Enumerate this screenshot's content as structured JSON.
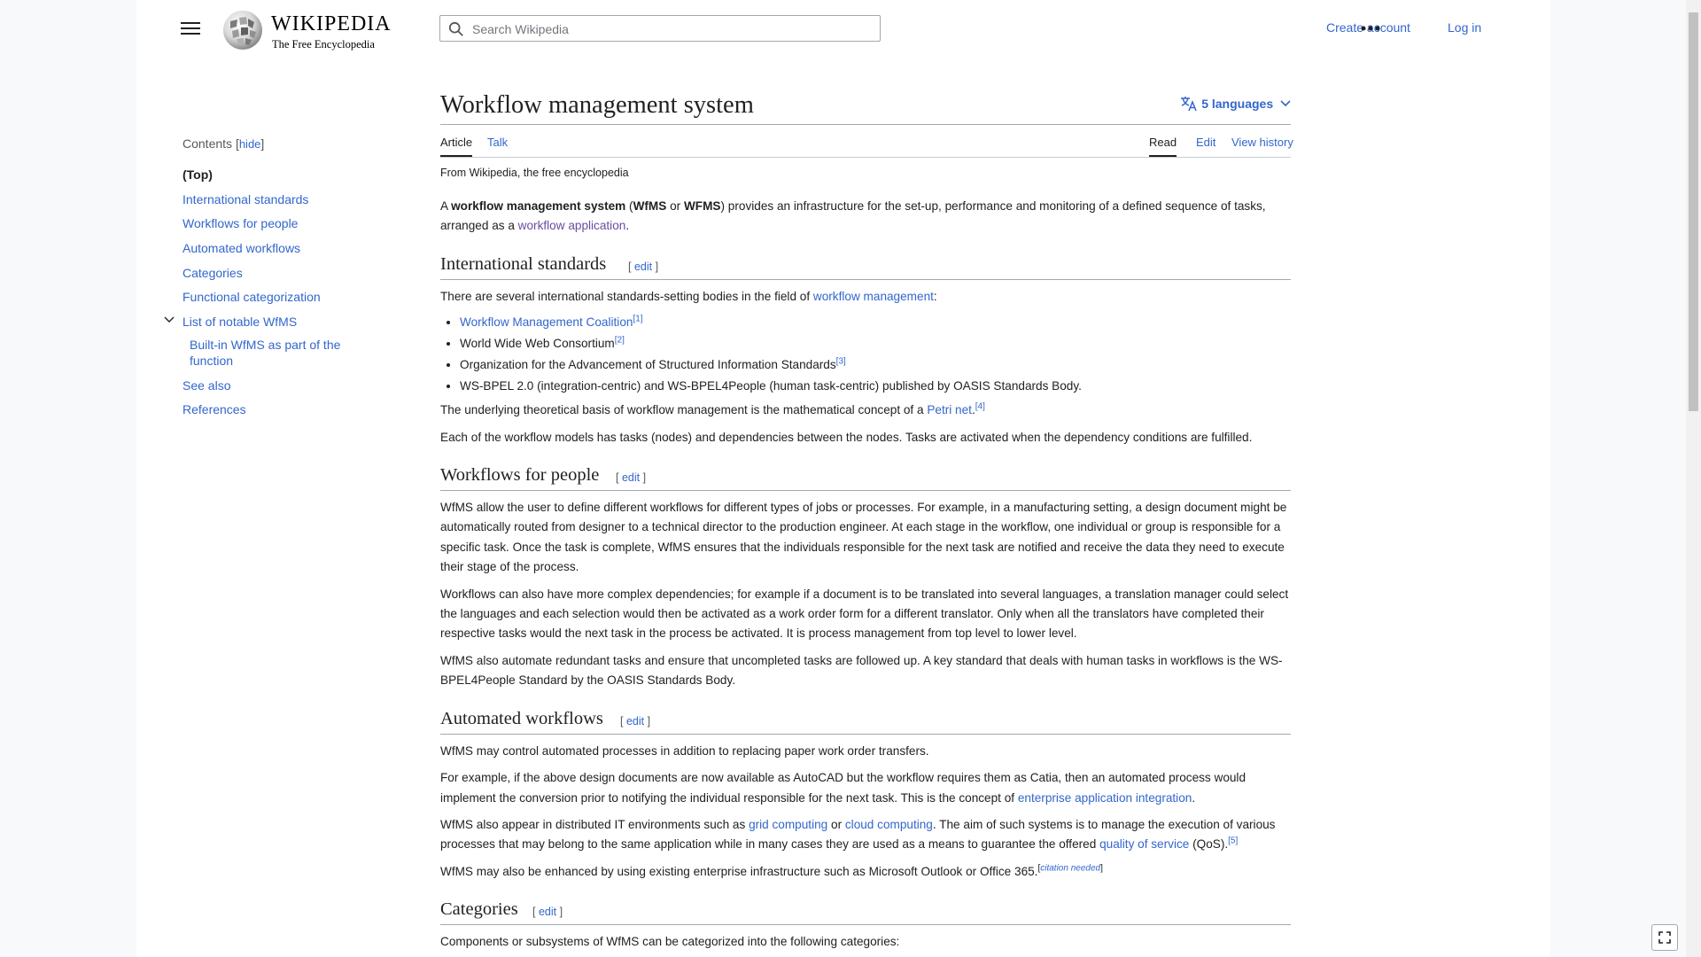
{
  "header": {
    "wordmark": "WIKIPEDIA",
    "tagline": "The Free Encyclopedia",
    "search_placeholder": "Search Wikipedia",
    "create_account": "Create account",
    "log_in": "Log in"
  },
  "toc": {
    "title": "Contents",
    "hide": "hide",
    "items": [
      "(Top)",
      "International standards",
      "Workflows for people",
      "Automated workflows",
      "Categories",
      "Functional categorization",
      "List of notable WfMS",
      "Built-in WfMS as part of the function",
      "See also",
      "References"
    ]
  },
  "article": {
    "title": "Workflow management system",
    "languages": "5 languages",
    "tabs": {
      "article": "Article",
      "talk": "Talk",
      "read": "Read",
      "edit": "Edit",
      "history": "View history"
    },
    "from": "From Wikipedia, the free encyclopedia",
    "edit_label": "edit",
    "intro": {
      "t1": "A ",
      "b1": "workflow management system",
      "t2": " (",
      "b2": "WfMS",
      "t3": " or ",
      "b3": "WFMS",
      "t4": ") provides an infrastructure for the set-up, performance and monitoring of a defined sequence of tasks, arranged as a ",
      "link": "workflow application",
      "t5": "."
    },
    "s1": {
      "title": "International standards",
      "p1_text": "There are several international standards-setting bodies in the field of ",
      "p1_link": "workflow management",
      "p1_end": ":",
      "li1": "Workflow Management Coalition",
      "li1_ref": "[1]",
      "li2": "World Wide Web Consortium",
      "li2_ref": "[2]",
      "li3": "Organization for the Advancement of Structured Information Standards",
      "li3_ref": "[3]",
      "li4": "WS-BPEL 2.0 (integration-centric) and WS-BPEL4People (human task-centric) published by OASIS Standards Body.",
      "p2_text": "The underlying theoretical basis of workflow management is the mathematical concept of a ",
      "p2_link": "Petri net",
      "p2_end": ".",
      "p2_ref": "[4]",
      "p3": "Each of the workflow models has tasks (nodes) and dependencies between the nodes. Tasks are activated when the dependency conditions are fulfilled."
    },
    "s2": {
      "title": "Workflows for people",
      "p1": "WfMS allow the user to define different workflows for different types of jobs or processes. For example, in a manufacturing setting, a design document might be automatically routed from designer to a technical director to the production engineer. At each stage in the workflow, one individual or group is responsible for a specific task. Once the task is complete, WfMS ensures that the individuals responsible for the next task are notified and receive the data they need to execute their stage of the process.",
      "p2": "Workflows can also have more complex dependencies; for example if a document is to be translated into several languages, a translation manager could select the languages and each selection would then be activated as a work order form for a different translator. Only when all the translators have completed their respective tasks would the next task in the process be activated. It is process management from top level to lower level.",
      "p3": "WfMS also automate redundant tasks and ensure that uncompleted tasks are followed up. A key standard that deals with human tasks in workflows is the WS-BPEL4People Standard by the OASIS Standards Body."
    },
    "s3": {
      "title": "Automated workflows",
      "p1": "WfMS may control automated processes in addition to replacing paper work order transfers.",
      "p2_text": "For example, if the above design documents are now available as AutoCAD but the workflow requires them as Catia, then an automated process would implement the conversion prior to notifying the individual responsible for the next task. This is the concept of ",
      "p2_link": "enterprise application integration",
      "p2_end": ".",
      "p3_a": "WfMS also appear in distributed IT environments such as ",
      "p3_link1": "grid computing",
      "p3_b": " or ",
      "p3_link2": "cloud computing",
      "p3_c": ". The aim of such systems is to manage the execution of various processes that may belong to the same application while in many cases they are used as a means to guarantee the offered ",
      "p3_link3": "quality of service",
      "p3_d": " (QoS).",
      "p3_ref": "[5]",
      "p4": "WfMS may also be enhanced by using existing enterprise infrastructure such as Microsoft Outlook or Office 365.",
      "p4_ref": "citation needed"
    },
    "s4": {
      "title": "Categories",
      "p1": "Components or subsystems of WfMS can be categorized into the following categories:"
    }
  }
}
